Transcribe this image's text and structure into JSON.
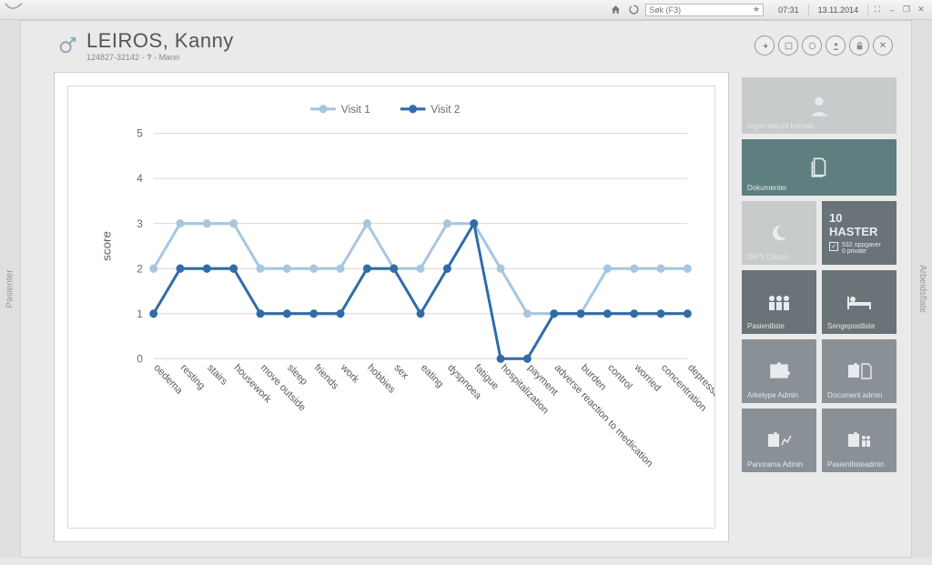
{
  "topbar": {
    "search_placeholder": "Søk (F3)",
    "time": "07:31",
    "date": "13.11.2014"
  },
  "side_tabs": {
    "left": "Pasienter",
    "right": "Arbeidsflate"
  },
  "patient": {
    "surname": "LEIROS",
    "given": "Kanny",
    "full": "LEIROS, Kanny",
    "id": "124827-32142",
    "unknown": "?",
    "gender_label": "Mann"
  },
  "tiles": {
    "no_context": "Ingen aktuell kontakt",
    "documents": "Dokumenter",
    "dps": "DIPS Classic",
    "haster_count": "10 HASTER",
    "haster_sub1": "532 oppgaver",
    "haster_sub2": "0 private",
    "patientlist": "Pasientliste",
    "bedlist": "Sengepostliste",
    "arketype": "Arketype Admin",
    "docadmin": "Document admin",
    "panorama": "Panorama Admin",
    "pasientliste": "Pasientlisteadmin"
  },
  "chart_data": {
    "type": "line",
    "ylabel": "score",
    "ylim": [
      0,
      5
    ],
    "yticks": [
      0,
      1,
      2,
      3,
      4,
      5
    ],
    "categories": [
      "oedema",
      "resting",
      "stairs",
      "housework",
      "move outside",
      "sleep",
      "friends",
      "work",
      "hobbies",
      "sex",
      "eating",
      "dyspnoea",
      "fatigue",
      "hospitalization",
      "payment",
      "adverse reaction to medication",
      "burden",
      "control",
      "worried",
      "concentration",
      "depressed"
    ],
    "series": [
      {
        "name": "Visit 1",
        "color": "#a7c6e0",
        "values": [
          2,
          3,
          3,
          3,
          2,
          2,
          2,
          2,
          3,
          2,
          2,
          3,
          3,
          2,
          1,
          1,
          1,
          2,
          2,
          2,
          2
        ]
      },
      {
        "name": "Visit 2",
        "color": "#2f6ca8",
        "values": [
          1,
          2,
          2,
          2,
          1,
          1,
          1,
          1,
          2,
          2,
          1,
          2,
          3,
          0,
          0,
          1,
          1,
          1,
          1,
          1,
          1
        ]
      }
    ]
  }
}
